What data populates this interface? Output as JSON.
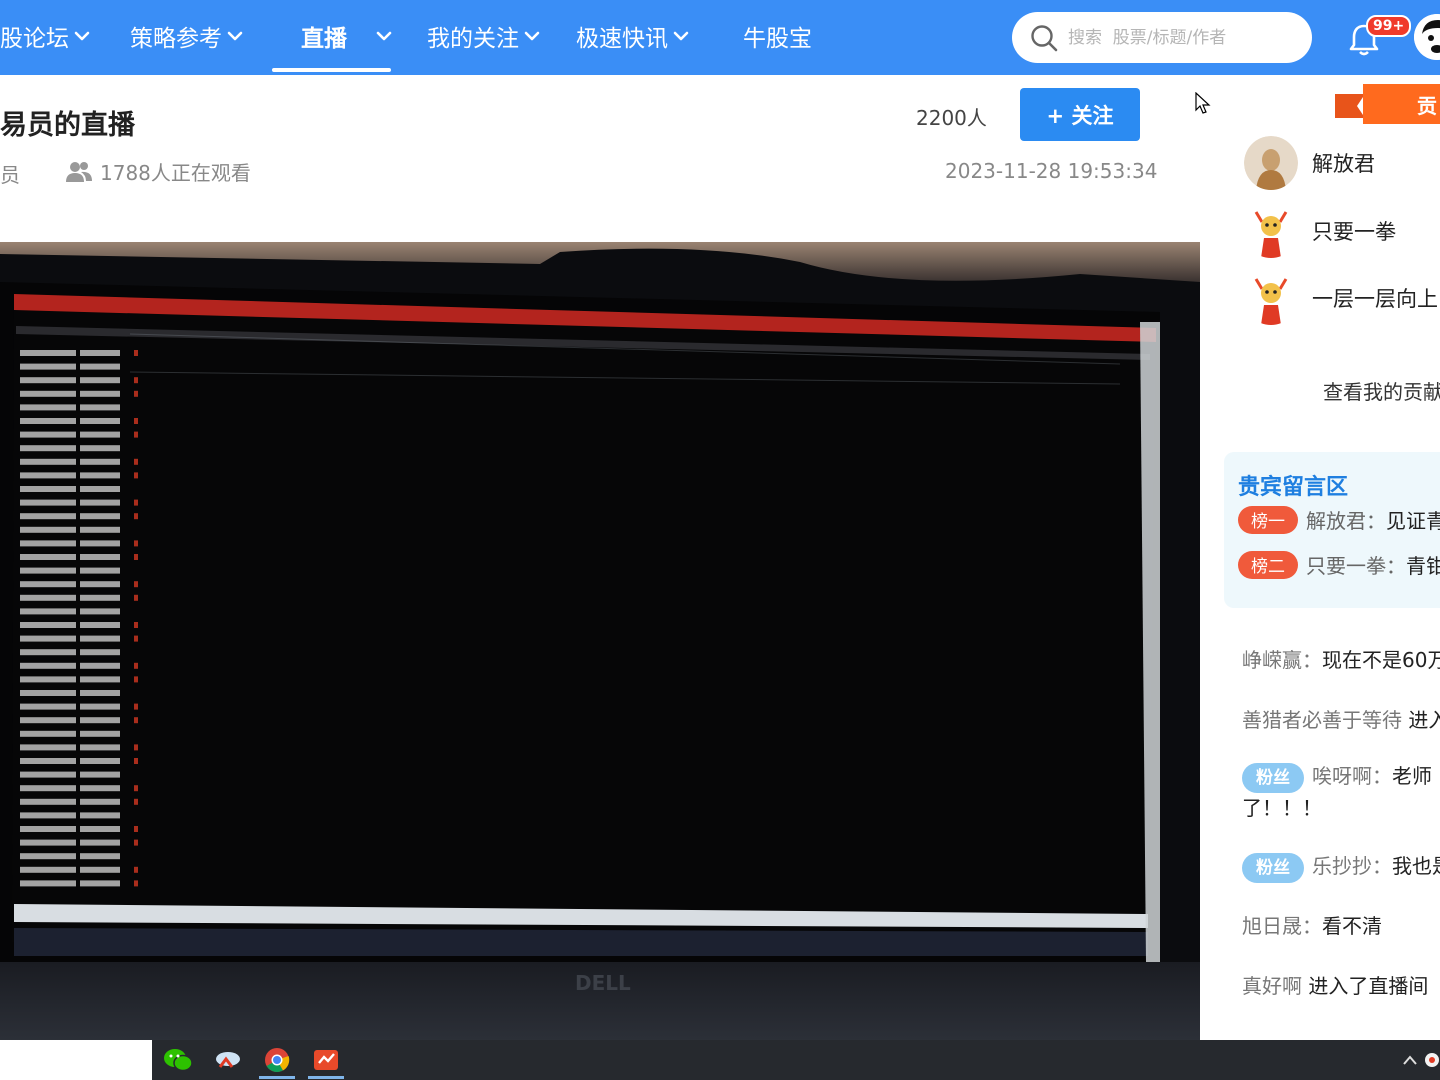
{
  "nav": {
    "items": [
      {
        "label": "股论坛",
        "has_dropdown": true
      },
      {
        "label": "策略参考",
        "has_dropdown": true
      },
      {
        "label": "直播",
        "has_dropdown": true,
        "active": true
      },
      {
        "label": "我的关注",
        "has_dropdown": true
      },
      {
        "label": "极速快讯",
        "has_dropdown": true
      },
      {
        "label": "牛股宝",
        "has_dropdown": false
      }
    ],
    "search_placeholder": "搜索  股票/标题/作者",
    "notification_badge": "99+"
  },
  "stream": {
    "title": "易员的直播",
    "host_role": "员",
    "viewers_text": "1788人正在观看",
    "follower_count": "2200人",
    "follow_label": "+ 关注",
    "timestamp": "2023-11-28 19:53:34"
  },
  "sidebar": {
    "ribbon_label": "贡",
    "contributors": [
      {
        "name": "解放君"
      },
      {
        "name": "只要一拳"
      },
      {
        "name": "一层一层向上"
      }
    ],
    "contrib_link": "查看我的贡献",
    "vip": {
      "title": "贵宾留言区",
      "rows": [
        {
          "badge": "榜一",
          "user": "解放君：",
          "text": "见证青"
        },
        {
          "badge": "榜二",
          "user": "只要一拳：",
          "text": "青钳"
        }
      ]
    },
    "chat": [
      {
        "user": "峥嵘赢：",
        "text": "现在不是60万",
        "fan": ""
      },
      {
        "user": "善猎者必善于等待",
        "text": " 进入",
        "fan": ""
      },
      {
        "user": "唉呀啊：",
        "text": "老师",
        "fan": "粉丝",
        "line2": "了！！！"
      },
      {
        "user": "乐抄抄：",
        "text": "我也是",
        "fan": "粉丝"
      },
      {
        "user": "旭日晟：",
        "text": "看不清",
        "fan": ""
      },
      {
        "user": "真好啊",
        "text": " 进入了直播间",
        "fan": ""
      }
    ]
  },
  "colors": {
    "nav_bg": "#3a8ef6",
    "follow_bg": "#2b8bf2",
    "rank_badge": "#f05a3b",
    "fan_badge": "#8cc9f3",
    "vip_title": "#1f7fe0"
  }
}
